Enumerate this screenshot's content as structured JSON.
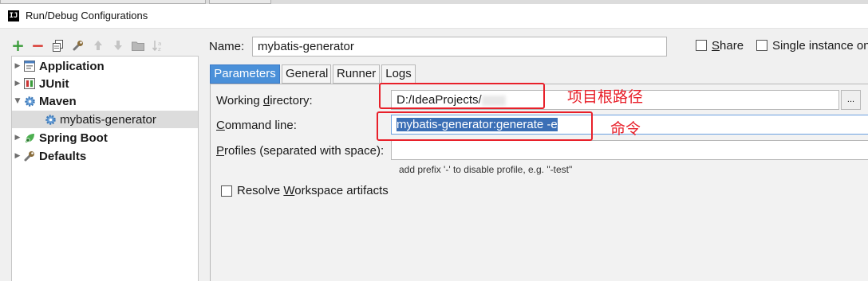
{
  "window": {
    "title": "Run/Debug Configurations",
    "app_icon_text": "IJ"
  },
  "toolbar": {
    "buttons": [
      "add-icon",
      "remove-icon",
      "copy-icon",
      "wrench-icon",
      "move-up-icon",
      "move-down-icon",
      "folder-icon",
      "sort-icon"
    ]
  },
  "tree": {
    "items": [
      {
        "label": "Application",
        "icon": "application-icon",
        "expanded": false
      },
      {
        "label": "JUnit",
        "icon": "junit-icon",
        "expanded": false
      },
      {
        "label": "Maven",
        "icon": "maven-gear-icon",
        "expanded": true
      },
      {
        "label": "mybatis-generator",
        "icon": "maven-gear-icon",
        "selected": true
      },
      {
        "label": "Spring Boot",
        "icon": "spring-boot-icon",
        "expanded": false
      },
      {
        "label": "Defaults",
        "icon": "wrench-icon",
        "expanded": false
      }
    ]
  },
  "config": {
    "name_label": "Name:",
    "name_value": "mybatis-generator",
    "share_label": "Share",
    "single_instance_label": "Single instance only",
    "share_checked": false,
    "single_instance_checked": false
  },
  "tabs": [
    {
      "label": "Parameters",
      "active": true
    },
    {
      "label": "General",
      "active": false
    },
    {
      "label": "Runner",
      "active": false
    },
    {
      "label": "Logs",
      "active": false
    }
  ],
  "parameters": {
    "working_dir_label": "Working directory:",
    "working_dir_value": "D:/IdeaProjects/",
    "browse_button": "...",
    "command_line_label": "Command line:",
    "command_line_value": "mybatis-generator:generate -e",
    "profiles_label": "Profiles (separated with space):",
    "profiles_value": "",
    "profiles_hint": "add prefix '-' to disable profile, e.g. \"-test\"",
    "resolve_workspace_label": "Resolve Workspace artifacts",
    "resolve_workspace_checked": false
  },
  "annotations": {
    "project_root": "项目根路径",
    "command": "命令",
    "color": "#e8202a"
  },
  "colors": {
    "active_tab": "#4a90d9",
    "selection": "#3b6fb6",
    "tree_selected": "#dcdcdc"
  }
}
